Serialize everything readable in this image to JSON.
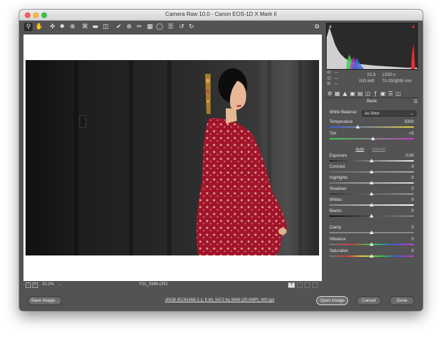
{
  "window": {
    "title": "Camera Raw 10.0  -  Canon EOS-1D X Mark II"
  },
  "toolbar": {
    "icons": [
      "zoom-icon",
      "hand-icon",
      "white-balance-icon",
      "color-sampler-icon",
      "target-adjust-icon",
      "crop-icon",
      "straighten-icon",
      "transform-icon",
      "spot-removal-icon",
      "red-eye-icon",
      "adjustment-brush-icon",
      "graduated-filter-icon",
      "radial-filter-icon",
      "preferences-icon",
      "rotate-ccw-icon",
      "rotate-cw-icon"
    ],
    "fullscreen_icon": "fullscreen-icon"
  },
  "status": {
    "zoom": "31.2%",
    "filename": "F21_0386.CR2",
    "compare_label": "Y"
  },
  "camera_info": {
    "r_label": "R:",
    "r_value": "---",
    "g_label": "G:",
    "g_value": "---",
    "b_label": "B:",
    "b_value": "---",
    "aperture": "f/2.8",
    "shutter": "1/250 s",
    "iso": "ISO 640",
    "lens": "70-200@95 mm"
  },
  "panel": {
    "title": "Basic",
    "white_balance_label": "White Balance:",
    "white_balance_value": "As Shot",
    "auto_label": "Auto",
    "default_label": "Default",
    "sliders": {
      "temperature": {
        "label": "Temperature",
        "value": "5300",
        "position": 0.34
      },
      "tint": {
        "label": "Tint",
        "value": "+5",
        "position": 0.52
      },
      "exposure": {
        "label": "Exposure",
        "value": "0.00",
        "position": 0.5
      },
      "contrast": {
        "label": "Contrast",
        "value": "0",
        "position": 0.5
      },
      "highlights": {
        "label": "Highlights",
        "value": "0",
        "position": 0.5
      },
      "shadows": {
        "label": "Shadows",
        "value": "0",
        "position": 0.5
      },
      "whites": {
        "label": "Whites",
        "value": "0",
        "position": 0.5
      },
      "blacks": {
        "label": "Blacks",
        "value": "0",
        "position": 0.5
      },
      "clarity": {
        "label": "Clarity",
        "value": "0",
        "position": 0.5
      },
      "vibrance": {
        "label": "Vibrance",
        "value": "0",
        "position": 0.5
      },
      "saturation": {
        "label": "Saturation",
        "value": "0",
        "position": 0.5
      }
    }
  },
  "footer": {
    "save_image": "Save Image...",
    "workflow_info": "sRGB IEC61966-2.1; 8 bit; 5472 by 3648 (20.0MP); 300 ppi",
    "open_image": "Open Image",
    "cancel": "Cancel",
    "done": "Done"
  },
  "colors": {
    "background": "#535353",
    "accent": "#dcdcdc"
  }
}
